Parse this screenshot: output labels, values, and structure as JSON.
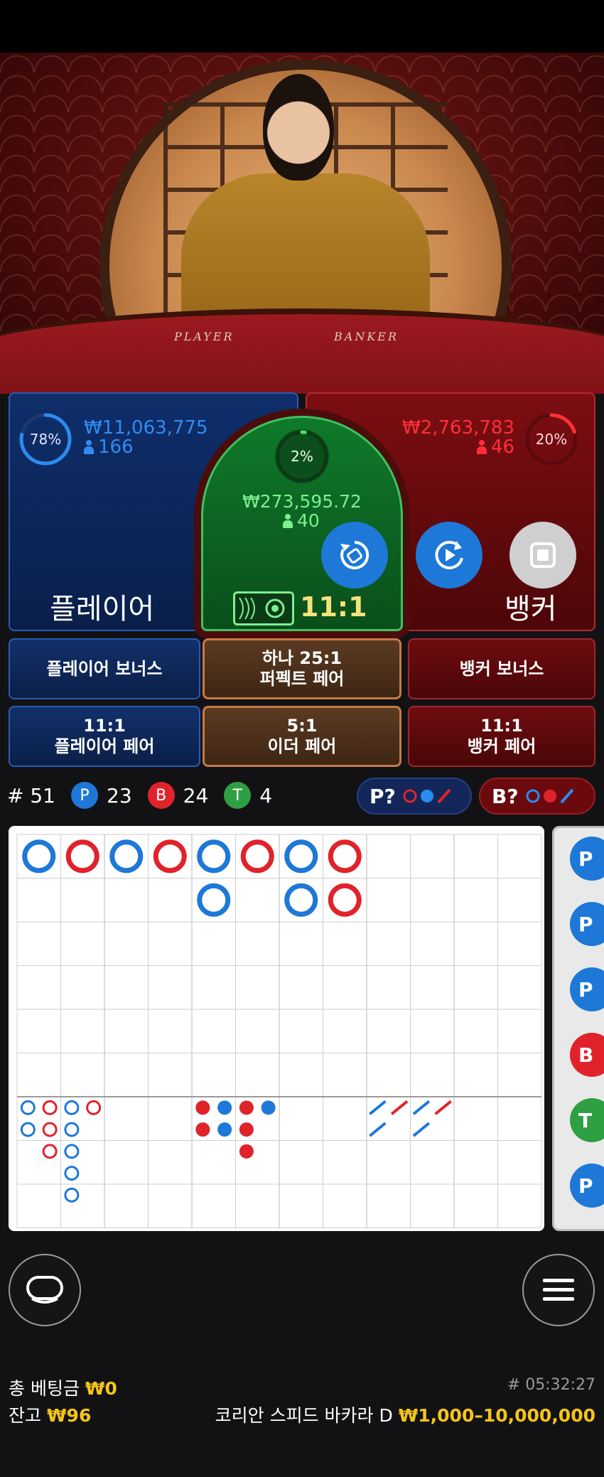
{
  "bets": {
    "player": {
      "percent": "78%",
      "percent_value": 78,
      "amount": "₩11,063,775",
      "players": "166",
      "name": "플레이어"
    },
    "banker": {
      "percent": "20%",
      "percent_value": 20,
      "amount": "₩2,763,783",
      "players": "46",
      "name": "뱅커"
    },
    "tie": {
      "percent": "2%",
      "percent_value": 2,
      "amount": "₩273,595.72",
      "players": "40",
      "payout": "11:1"
    }
  },
  "video": {
    "player_label": "PLAYER",
    "banker_label": "BANKER"
  },
  "side_bets": {
    "player_bonus": "플레이어 보너스",
    "perfect_pair_line1": "하나 25:1",
    "perfect_pair_line2": "퍼펙트 페어",
    "banker_bonus": "뱅커 보너스",
    "player_pair_line1": "11:1",
    "player_pair_line2": "플레이어 페어",
    "either_pair_line1": "5:1",
    "either_pair_line2": "이더 페어",
    "banker_pair_line1": "11:1",
    "banker_pair_line2": "뱅커 페어"
  },
  "stats": {
    "round": "# 51",
    "p_label": "P",
    "p_count": "23",
    "b_label": "B",
    "b_count": "24",
    "t_label": "T",
    "t_count": "4"
  },
  "predict": {
    "player": "P?",
    "banker": "B?"
  },
  "big_road": [
    [
      "P"
    ],
    [
      "B"
    ],
    [
      "P"
    ],
    [
      "B"
    ],
    [
      "P",
      "P"
    ],
    [
      "B"
    ],
    [
      "P",
      "P"
    ],
    [
      "B",
      "B"
    ]
  ],
  "big_eye_road": [
    [
      "P",
      "P"
    ],
    [
      "B",
      "B",
      "B"
    ],
    [
      "P",
      "P",
      "P",
      "P",
      "P"
    ],
    [
      "B"
    ]
  ],
  "small_road": [
    [
      "R",
      "R"
    ],
    [
      "B",
      "B"
    ],
    [
      "R",
      "R",
      "R"
    ],
    [
      "B"
    ]
  ],
  "cockroach_road": [
    [
      "B",
      "B"
    ],
    [
      "R"
    ],
    [
      "B",
      "B"
    ],
    [
      "R"
    ]
  ],
  "side_road_items": [
    "P",
    "P",
    "P",
    "B",
    "T",
    "P"
  ],
  "footer": {
    "total_bet_label": "총 베팅금",
    "total_bet_value": "₩0",
    "balance_label": "잔고",
    "balance_value": "₩96",
    "round_time": "# 05:32:27",
    "table_name": "코리안 스피드 바카라 D",
    "limits": "₩1,000–10,000,000"
  },
  "colors": {
    "player": "#1d78d8",
    "banker": "#e0232b",
    "tie": "#2ea043",
    "gold": "#f5c518"
  },
  "icons": {
    "undo": "undo-icon",
    "repeat": "repeat-icon",
    "stop": "stop-icon",
    "chat": "chat-icon",
    "menu": "menu-icon",
    "chip": "chip-icon"
  }
}
